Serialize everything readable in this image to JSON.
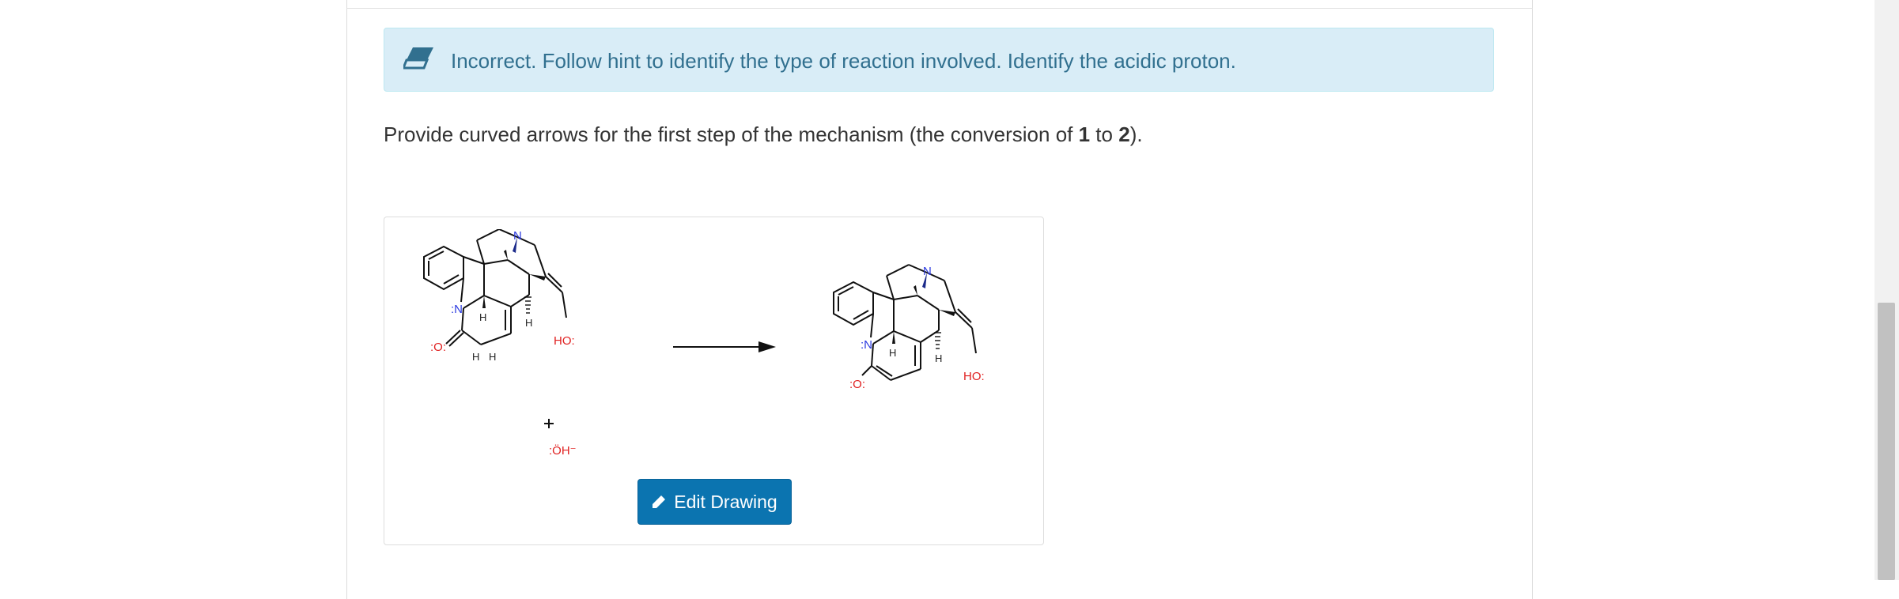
{
  "feedback": {
    "message": "Incorrect. Follow hint to identify the type of reaction involved. Identify the acidic proton.",
    "icon": "eraser-icon",
    "color": "#31708f",
    "background": "#d9edf7"
  },
  "question": {
    "text_before": "Provide curved arrows for the first step of the mechanism (the conversion of ",
    "start_compound": "1",
    "text_middle": " to ",
    "end_compound": "2",
    "text_after": ")."
  },
  "drawing": {
    "reactant_labels": {
      "n": ":N",
      "h_left": "H",
      "h_right": "H",
      "h_bottom1": "H",
      "h_bottom2": "H",
      "o_carbonyl": ":O:",
      "ho": "HO:"
    },
    "reagent": {
      "plus": "+",
      "hydroxide": ":ÖH⁻"
    },
    "product_labels": {
      "n": ":N",
      "h_left": "H",
      "h_right": "H",
      "o_enolate": ":O:",
      "ho": "HO:"
    },
    "edit_button_label": "Edit Drawing",
    "button_color": "#0b74b0"
  }
}
